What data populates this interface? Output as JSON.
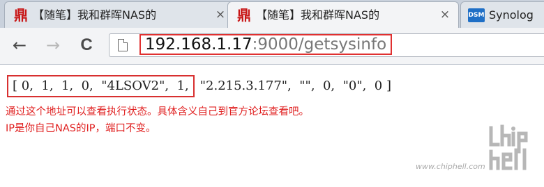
{
  "browser": {
    "tabs": [
      {
        "icon": "chiphell-favicon",
        "icon_glyph": "鼎",
        "title": "【随笔】我和群晖NAS的",
        "active": false
      },
      {
        "icon": "chiphell-favicon",
        "icon_glyph": "鼎",
        "title": "【随笔】我和群晖NAS的",
        "active": true
      },
      {
        "icon": "dsm-favicon",
        "icon_text": "DSM",
        "title": "Synolog",
        "active": false
      }
    ],
    "close_glyph": "×",
    "nav": {
      "back": "←",
      "forward": "→",
      "reload": "C"
    },
    "address": {
      "host": "192.168.1.17",
      "rest": ":9000/getsysinfo"
    }
  },
  "page": {
    "response_boxed": "[ 0,  1,  1,  0,  \"4LSOV2\",  1,",
    "response_rest": "\"2.215.3.177\",  \"\",  0,  \"0\",  0 ]",
    "note_line1": "通过这个地址可以查看执行状态。具体含义自己到官方论坛查看吧。",
    "note_line2": "IP是你自己NAS的IP，端口不变。"
  },
  "watermark": {
    "url": "www.chiphell.com"
  },
  "colors": {
    "annotation_red": "#e02020",
    "tab_bg": "#c9d1dc",
    "toolbar_bg": "#f3f4f6"
  }
}
